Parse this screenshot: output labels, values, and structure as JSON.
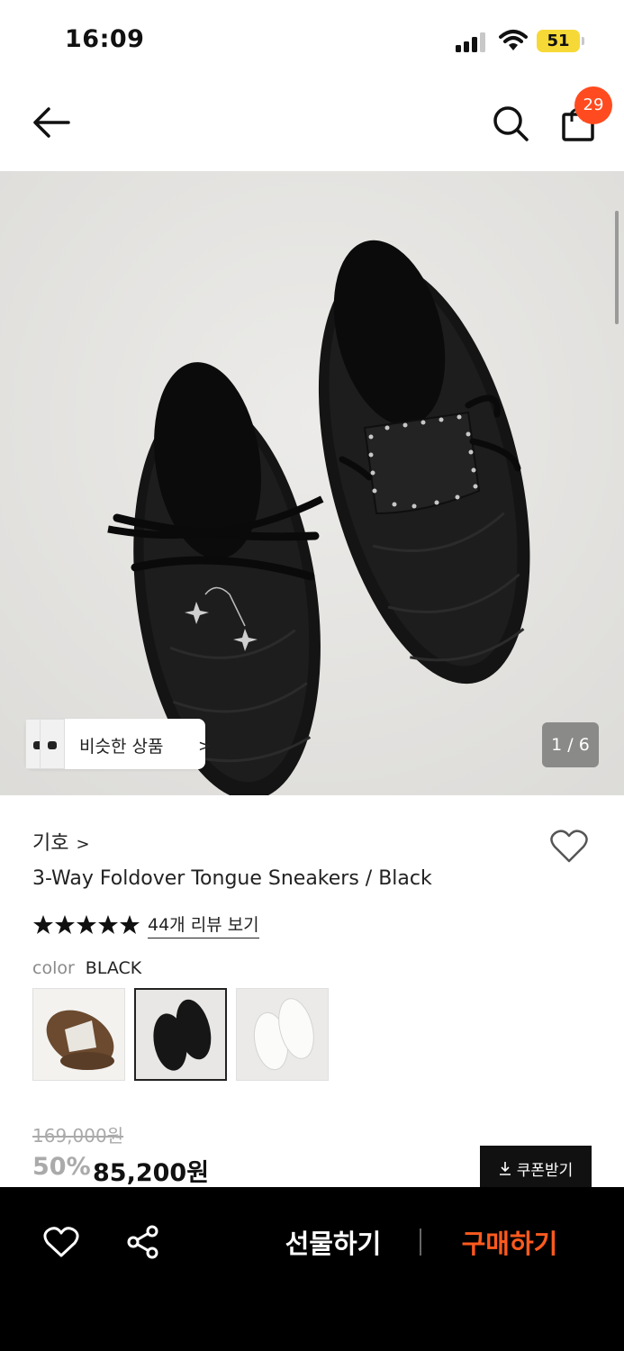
{
  "status": {
    "time": "16:09",
    "battery": "51"
  },
  "nav": {
    "cart_count": "29"
  },
  "gallery": {
    "similar_label": "비슷한 상품",
    "counter": "1 / 6"
  },
  "product": {
    "brand": "기호",
    "title": "3-Way Foldover Tongue Sneakers / Black",
    "rating_stars": 5,
    "review_link": "44개 리뷰 보기",
    "option_label": "color",
    "option_value": "BLACK",
    "swatches": [
      "brown",
      "black",
      "white"
    ],
    "selected_swatch": "black"
  },
  "price": {
    "original": "169,000원",
    "discount": "50%",
    "sale": "85,200원",
    "coupon_label": "쿠폰받기"
  },
  "bottom_bar": {
    "gift_label": "선물하기",
    "buy_label": "구매하기"
  },
  "colors": {
    "accent": "#ff5a1e",
    "badge": "#ff4b1f",
    "battery": "#f6d937"
  }
}
